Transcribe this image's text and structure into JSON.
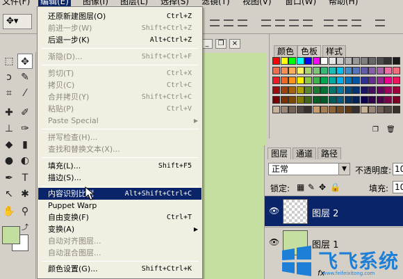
{
  "menubar": {
    "items": [
      {
        "label": "文件(F)"
      },
      {
        "label": "编辑(E)",
        "active": true
      },
      {
        "label": "图像(I)"
      },
      {
        "label": "图层(L)"
      },
      {
        "label": "选择(S)"
      },
      {
        "label": "滤镜(T)"
      },
      {
        "label": "视图(V)"
      },
      {
        "label": "窗口(W)"
      },
      {
        "label": "帮助(H)"
      }
    ]
  },
  "edit_menu": {
    "items": [
      {
        "label": "还原新建图层(O)",
        "shortcut": "Ctrl+Z",
        "disabled": false
      },
      {
        "label": "前进一步(W)",
        "shortcut": "Shift+Ctrl+Z",
        "disabled": true
      },
      {
        "label": "后退一步(K)",
        "shortcut": "Alt+Ctrl+Z",
        "disabled": false
      },
      {
        "label": "渐隐(D)...",
        "shortcut": "Shift+Ctrl+F",
        "disabled": true
      },
      {
        "label": "剪切(T)",
        "shortcut": "Ctrl+X",
        "disabled": true
      },
      {
        "label": "拷贝(C)",
        "shortcut": "Ctrl+C",
        "disabled": true
      },
      {
        "label": "合并拷贝(Y)",
        "shortcut": "Shift+Ctrl+C",
        "disabled": true
      },
      {
        "label": "粘贴(P)",
        "shortcut": "Ctrl+V",
        "disabled": true
      },
      {
        "label": "Paste Special",
        "shortcut": "",
        "disabled": true
      },
      {
        "label": "拼写检查(H)...",
        "shortcut": "",
        "disabled": true
      },
      {
        "label": "查找和替换文本(X)...",
        "shortcut": "",
        "disabled": true
      },
      {
        "label": "填充(L)...",
        "shortcut": "Shift+F5",
        "disabled": false
      },
      {
        "label": "描边(S)...",
        "shortcut": "",
        "disabled": false
      },
      {
        "label": "内容识别比例",
        "shortcut": "Alt+Shift+Ctrl+C",
        "disabled": false,
        "highlighted": true
      },
      {
        "label": "Puppet Warp",
        "shortcut": "",
        "disabled": false
      },
      {
        "label": "自由变换(F)",
        "shortcut": "Ctrl+T",
        "disabled": false
      },
      {
        "label": "变换(A)",
        "shortcut": "",
        "disabled": false
      },
      {
        "label": "自动对齐图层...",
        "shortcut": "",
        "disabled": true
      },
      {
        "label": "自动混合图层...",
        "shortcut": "",
        "disabled": true
      },
      {
        "label": "颜色设置(G)...",
        "shortcut": "Shift+Ctrl+K",
        "disabled": false
      }
    ]
  },
  "swatch_panel": {
    "tabs": [
      "颜色",
      "色板",
      "样式"
    ],
    "active_tab": "色板"
  },
  "layers_panel": {
    "tabs": [
      "图层",
      "通道",
      "路径"
    ],
    "blend_mode": "正常",
    "opacity_label": "不透明度:",
    "opacity_value": "10",
    "lock_label": "锁定:",
    "fill_label": "填充:",
    "fill_value": "10",
    "layers": [
      {
        "name": "图层 2",
        "selected": true,
        "thumb": "transparent"
      },
      {
        "name": "图层 1",
        "selected": false,
        "thumb": "#c5dfa0"
      }
    ]
  },
  "watermark": {
    "text": "飞飞系统",
    "url": "www.feifeixitong.com"
  },
  "colors": {
    "menu_highlight": "#0a246a",
    "canvas_green": "#c5dfa0",
    "watermark_blue": "#1e7fd6"
  }
}
